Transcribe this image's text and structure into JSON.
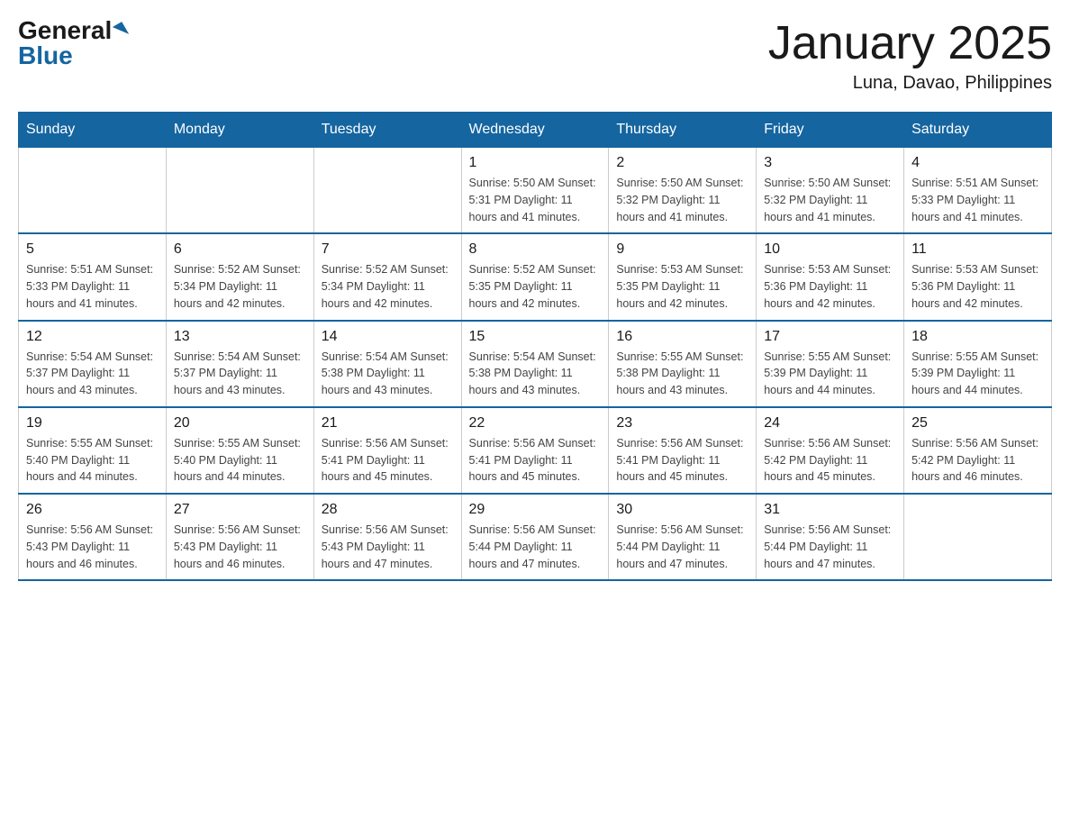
{
  "logo": {
    "general": "General",
    "blue": "Blue"
  },
  "title": "January 2025",
  "subtitle": "Luna, Davao, Philippines",
  "days_header": [
    "Sunday",
    "Monday",
    "Tuesday",
    "Wednesday",
    "Thursday",
    "Friday",
    "Saturday"
  ],
  "weeks": [
    [
      {
        "day": "",
        "info": ""
      },
      {
        "day": "",
        "info": ""
      },
      {
        "day": "",
        "info": ""
      },
      {
        "day": "1",
        "info": "Sunrise: 5:50 AM\nSunset: 5:31 PM\nDaylight: 11 hours\nand 41 minutes."
      },
      {
        "day": "2",
        "info": "Sunrise: 5:50 AM\nSunset: 5:32 PM\nDaylight: 11 hours\nand 41 minutes."
      },
      {
        "day": "3",
        "info": "Sunrise: 5:50 AM\nSunset: 5:32 PM\nDaylight: 11 hours\nand 41 minutes."
      },
      {
        "day": "4",
        "info": "Sunrise: 5:51 AM\nSunset: 5:33 PM\nDaylight: 11 hours\nand 41 minutes."
      }
    ],
    [
      {
        "day": "5",
        "info": "Sunrise: 5:51 AM\nSunset: 5:33 PM\nDaylight: 11 hours\nand 41 minutes."
      },
      {
        "day": "6",
        "info": "Sunrise: 5:52 AM\nSunset: 5:34 PM\nDaylight: 11 hours\nand 42 minutes."
      },
      {
        "day": "7",
        "info": "Sunrise: 5:52 AM\nSunset: 5:34 PM\nDaylight: 11 hours\nand 42 minutes."
      },
      {
        "day": "8",
        "info": "Sunrise: 5:52 AM\nSunset: 5:35 PM\nDaylight: 11 hours\nand 42 minutes."
      },
      {
        "day": "9",
        "info": "Sunrise: 5:53 AM\nSunset: 5:35 PM\nDaylight: 11 hours\nand 42 minutes."
      },
      {
        "day": "10",
        "info": "Sunrise: 5:53 AM\nSunset: 5:36 PM\nDaylight: 11 hours\nand 42 minutes."
      },
      {
        "day": "11",
        "info": "Sunrise: 5:53 AM\nSunset: 5:36 PM\nDaylight: 11 hours\nand 42 minutes."
      }
    ],
    [
      {
        "day": "12",
        "info": "Sunrise: 5:54 AM\nSunset: 5:37 PM\nDaylight: 11 hours\nand 43 minutes."
      },
      {
        "day": "13",
        "info": "Sunrise: 5:54 AM\nSunset: 5:37 PM\nDaylight: 11 hours\nand 43 minutes."
      },
      {
        "day": "14",
        "info": "Sunrise: 5:54 AM\nSunset: 5:38 PM\nDaylight: 11 hours\nand 43 minutes."
      },
      {
        "day": "15",
        "info": "Sunrise: 5:54 AM\nSunset: 5:38 PM\nDaylight: 11 hours\nand 43 minutes."
      },
      {
        "day": "16",
        "info": "Sunrise: 5:55 AM\nSunset: 5:38 PM\nDaylight: 11 hours\nand 43 minutes."
      },
      {
        "day": "17",
        "info": "Sunrise: 5:55 AM\nSunset: 5:39 PM\nDaylight: 11 hours\nand 44 minutes."
      },
      {
        "day": "18",
        "info": "Sunrise: 5:55 AM\nSunset: 5:39 PM\nDaylight: 11 hours\nand 44 minutes."
      }
    ],
    [
      {
        "day": "19",
        "info": "Sunrise: 5:55 AM\nSunset: 5:40 PM\nDaylight: 11 hours\nand 44 minutes."
      },
      {
        "day": "20",
        "info": "Sunrise: 5:55 AM\nSunset: 5:40 PM\nDaylight: 11 hours\nand 44 minutes."
      },
      {
        "day": "21",
        "info": "Sunrise: 5:56 AM\nSunset: 5:41 PM\nDaylight: 11 hours\nand 45 minutes."
      },
      {
        "day": "22",
        "info": "Sunrise: 5:56 AM\nSunset: 5:41 PM\nDaylight: 11 hours\nand 45 minutes."
      },
      {
        "day": "23",
        "info": "Sunrise: 5:56 AM\nSunset: 5:41 PM\nDaylight: 11 hours\nand 45 minutes."
      },
      {
        "day": "24",
        "info": "Sunrise: 5:56 AM\nSunset: 5:42 PM\nDaylight: 11 hours\nand 45 minutes."
      },
      {
        "day": "25",
        "info": "Sunrise: 5:56 AM\nSunset: 5:42 PM\nDaylight: 11 hours\nand 46 minutes."
      }
    ],
    [
      {
        "day": "26",
        "info": "Sunrise: 5:56 AM\nSunset: 5:43 PM\nDaylight: 11 hours\nand 46 minutes."
      },
      {
        "day": "27",
        "info": "Sunrise: 5:56 AM\nSunset: 5:43 PM\nDaylight: 11 hours\nand 46 minutes."
      },
      {
        "day": "28",
        "info": "Sunrise: 5:56 AM\nSunset: 5:43 PM\nDaylight: 11 hours\nand 47 minutes."
      },
      {
        "day": "29",
        "info": "Sunrise: 5:56 AM\nSunset: 5:44 PM\nDaylight: 11 hours\nand 47 minutes."
      },
      {
        "day": "30",
        "info": "Sunrise: 5:56 AM\nSunset: 5:44 PM\nDaylight: 11 hours\nand 47 minutes."
      },
      {
        "day": "31",
        "info": "Sunrise: 5:56 AM\nSunset: 5:44 PM\nDaylight: 11 hours\nand 47 minutes."
      },
      {
        "day": "",
        "info": ""
      }
    ]
  ]
}
